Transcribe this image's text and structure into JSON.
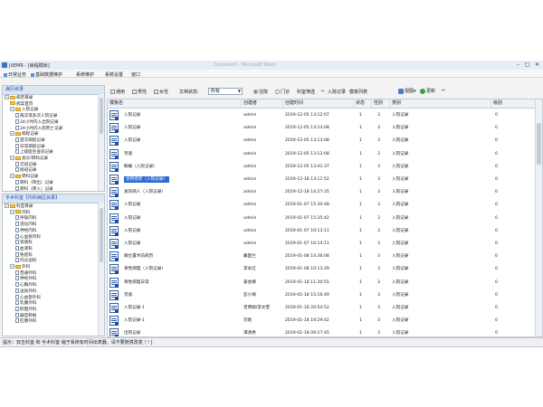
{
  "window": {
    "title": "JXEMR - [病程模板]",
    "background_title": "Document - Microsoft Word",
    "controls": [
      "–",
      "□",
      "✕"
    ]
  },
  "menu": [
    "日常业务",
    "基础数据维护",
    "系统维护",
    "系统设置",
    "窗口"
  ],
  "tree_panel_1": {
    "header": "病历目录",
    "items": [
      {
        "label": "病历目录",
        "level": 0,
        "expander": "−",
        "type": "folder"
      },
      {
        "label": "病案首页",
        "level": 1,
        "expander": "",
        "type": "folder"
      },
      {
        "label": "入院记录",
        "level": 1,
        "expander": "−",
        "type": "folder"
      },
      {
        "label": "再次或多次入院记录",
        "level": 2,
        "expander": "",
        "type": "doc"
      },
      {
        "label": "24小时内入出院记录",
        "level": 2,
        "expander": "",
        "type": "doc"
      },
      {
        "label": "24小时内入院死亡记录",
        "level": 2,
        "expander": "",
        "type": "doc"
      },
      {
        "label": "病程记录",
        "level": 1,
        "expander": "−",
        "type": "folder"
      },
      {
        "label": "首次病程记录",
        "level": 2,
        "expander": "",
        "type": "doc"
      },
      {
        "label": "日常病程记录",
        "level": 2,
        "expander": "",
        "type": "doc"
      },
      {
        "label": "上级医生查房记录",
        "level": 2,
        "expander": "",
        "type": "doc"
      },
      {
        "label": "会诊/转科记录",
        "level": 1,
        "expander": "−",
        "type": "folder"
      },
      {
        "label": "交班记录",
        "level": 2,
        "expander": "",
        "type": "doc"
      },
      {
        "label": "接班记录",
        "level": 2,
        "expander": "",
        "type": "doc"
      },
      {
        "label": "转科记录",
        "level": 1,
        "expander": "−",
        "type": "folder"
      },
      {
        "label": "转科（转出）记录",
        "level": 2,
        "expander": "",
        "type": "doc"
      },
      {
        "label": "转科（转入）记录",
        "level": 2,
        "expander": "",
        "type": "doc"
      }
    ]
  },
  "tree_panel_2": {
    "header": "手术科室【内科病区目录】",
    "items": [
      {
        "label": "科室目录",
        "level": 0,
        "expander": "−",
        "type": "folder"
      },
      {
        "label": "内科",
        "level": 1,
        "expander": "−",
        "type": "folder"
      },
      {
        "label": "呼吸内科",
        "level": 2,
        "expander": "",
        "type": "doc"
      },
      {
        "label": "消化内科",
        "level": 2,
        "expander": "",
        "type": "doc"
      },
      {
        "label": "神经内科",
        "level": 2,
        "expander": "",
        "type": "doc"
      },
      {
        "label": "心血管内科",
        "level": 2,
        "expander": "",
        "type": "doc"
      },
      {
        "label": "肾病科",
        "level": 2,
        "expander": "",
        "type": "doc"
      },
      {
        "label": "血液科",
        "level": 2,
        "expander": "",
        "type": "doc"
      },
      {
        "label": "免疫科",
        "level": 2,
        "expander": "",
        "type": "doc"
      },
      {
        "label": "内分泌科",
        "level": 2,
        "expander": "",
        "type": "doc"
      },
      {
        "label": "外科",
        "level": 1,
        "expander": "−",
        "type": "folder"
      },
      {
        "label": "普通外科",
        "level": 2,
        "expander": "",
        "type": "doc"
      },
      {
        "label": "神经外科",
        "level": 2,
        "expander": "",
        "type": "doc"
      },
      {
        "label": "心胸外科",
        "level": 2,
        "expander": "",
        "type": "doc"
      },
      {
        "label": "泌尿外科",
        "level": 2,
        "expander": "",
        "type": "doc"
      },
      {
        "label": "心血管外科",
        "level": 2,
        "expander": "",
        "type": "doc"
      },
      {
        "label": "乳腺外科",
        "level": 2,
        "expander": "",
        "type": "doc"
      },
      {
        "label": "肝胆外科",
        "level": 2,
        "expander": "",
        "type": "doc"
      },
      {
        "label": "器官移植",
        "level": 2,
        "expander": "",
        "type": "doc"
      },
      {
        "label": "肛肠外科",
        "level": 2,
        "expander": "",
        "type": "doc"
      }
    ]
  },
  "filter": {
    "checkboxes": [
      {
        "label": "通用",
        "checked": true
      },
      {
        "label": "男性",
        "checked": true
      },
      {
        "label": "女性",
        "checked": true
      }
    ],
    "status_label": "文档状态:",
    "status_value": "所有",
    "radios": [
      {
        "label": "住院",
        "checked": true
      },
      {
        "label": "门诊",
        "checked": false
      }
    ],
    "dept_button": "科室筛选",
    "arrow": "→",
    "breadcrumb": "入院记录",
    "list_label": "模板列表",
    "view_button": "视图",
    "refresh_button": "更新",
    "back_icon": "⇐"
  },
  "table": {
    "columns": [
      "模板名",
      "创建者",
      "创建时间",
      "状态",
      "性别",
      "类别",
      "级别"
    ],
    "rows": [
      {
        "name": "入院记录",
        "creator": "admin",
        "time": "2019-12-05 13:12:07",
        "status": "1",
        "gender": "3",
        "type": "入院记录",
        "level": "0",
        "selected": false
      },
      {
        "name": "入院记录",
        "creator": "admin",
        "time": "2019-12-05 13:13:08",
        "status": "1",
        "gender": "3",
        "type": "入院记录",
        "level": "0",
        "selected": false
      },
      {
        "name": "入院记录",
        "creator": "admin",
        "time": "2019-12-05 13:13:08",
        "status": "1",
        "gender": "3",
        "type": "入院记录",
        "level": "0",
        "selected": false
      },
      {
        "name": "页眉",
        "creator": "admin",
        "time": "2019-12-05 13:13:08",
        "status": "1",
        "gender": "3",
        "type": "入院记录",
        "level": "0",
        "selected": false
      },
      {
        "name": "胸痛（入院记录）",
        "creator": "admin",
        "time": "2019-12-05 13:41:37",
        "status": "1",
        "gender": "3",
        "type": "入院记录",
        "level": "0",
        "selected": false
      },
      {
        "name": "甘特症状（入院记录）",
        "creator": "admin",
        "time": "2019-12-18 13:11:52",
        "status": "1",
        "gender": "3",
        "type": "入院记录",
        "level": "0",
        "selected": true
      },
      {
        "name": "发热病人（入院记录）",
        "creator": "admin",
        "time": "2019-12-18 14:27:35",
        "status": "1",
        "gender": "3",
        "type": "入院记录",
        "level": "0",
        "selected": false
      },
      {
        "name": "入院记录",
        "creator": "admin",
        "time": "2019-01-07 15:30:48",
        "status": "1",
        "gender": "3",
        "type": "入院记录",
        "level": "0",
        "selected": false
      },
      {
        "name": "入院记录",
        "creator": "admin",
        "time": "2019-01-07 15:35:42",
        "status": "1",
        "gender": "3",
        "type": "入院记录",
        "level": "0",
        "selected": false
      },
      {
        "name": "入院记录",
        "creator": "admin",
        "time": "2019-01-07 10:13:11",
        "status": "1",
        "gender": "3",
        "type": "入院记录",
        "level": "0",
        "selected": false
      },
      {
        "name": "入院记录",
        "creator": "admin",
        "time": "2019-01-07 10:14:11",
        "status": "1",
        "gender": "3",
        "type": "入院记录",
        "level": "0",
        "selected": false
      },
      {
        "name": "眼位置术前病历",
        "creator": "戴国兰",
        "time": "2019-01-08 14:36:08",
        "status": "1",
        "gender": "3",
        "type": "入院记录",
        "level": "0",
        "selected": false
      },
      {
        "name": "骨性病理（入院记录）",
        "creator": "李永红",
        "time": "2019-01-08 10:13:29",
        "status": "1",
        "gender": "3",
        "type": "入院记录",
        "level": "0",
        "selected": false
      },
      {
        "name": "骨性病理日常",
        "creator": "姜会娜",
        "time": "2019-01-18 11:30:55",
        "status": "1",
        "gender": "3",
        "type": "入院记录",
        "level": "0",
        "selected": false
      },
      {
        "name": "页眉",
        "creator": "彭小梅",
        "time": "2019-01-18 15:16:49",
        "status": "1",
        "gender": "3",
        "type": "入院记录",
        "level": "0",
        "selected": false
      },
      {
        "name": "入院记录-1",
        "creator": "曾明娟/李文雯",
        "time": "2019-01-18 20:54:52",
        "status": "1",
        "gender": "3",
        "type": "入院记录",
        "level": "0",
        "selected": false
      },
      {
        "name": "入院记录-1",
        "creator": "刘勋",
        "time": "2019-01-18 19:29:42",
        "status": "1",
        "gender": "3",
        "type": "入院记录",
        "level": "0",
        "selected": false
      },
      {
        "name": "出院记录",
        "creator": "谭清秀",
        "time": "2019-01-18 09:27:45",
        "status": "1",
        "gender": "3",
        "type": "入院记录",
        "level": "0",
        "selected": false
      }
    ]
  },
  "status_bar": "提示：双击科室 和 手术科室 缩于系统有时间出表器，请不要随意改变 ! ! ]"
}
